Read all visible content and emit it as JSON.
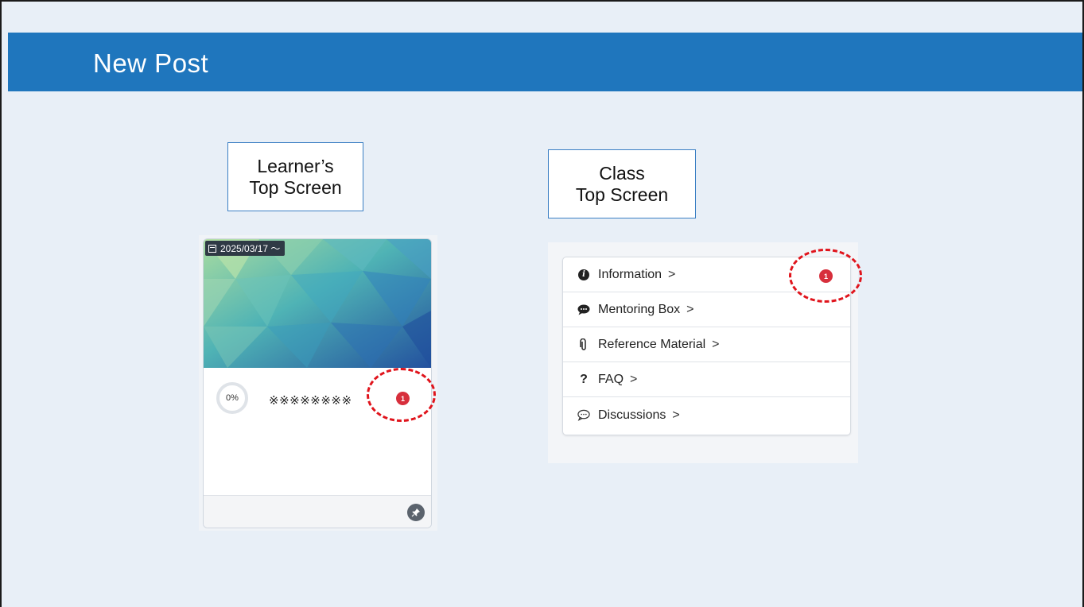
{
  "header": {
    "title": "New Post"
  },
  "labels": {
    "learner_line1": "Learner’s",
    "learner_line2": "Top Screen",
    "class_line1": "Class",
    "class_line2": "Top Screen"
  },
  "learner_card": {
    "date": "2025/03/17 ～",
    "progress": "0%",
    "title": "※※※※※※※※",
    "badge": "1"
  },
  "class_menu": {
    "items": [
      {
        "label": "Information",
        "icon": "info-icon"
      },
      {
        "label": "Mentoring Box",
        "icon": "chat-bubble-icon"
      },
      {
        "label": "Reference Material",
        "icon": "paperclip-icon"
      },
      {
        "label": "FAQ",
        "icon": "question-icon"
      },
      {
        "label": "Discussions",
        "icon": "comment-dots-icon"
      }
    ],
    "chevron": ">",
    "badge": "1"
  },
  "colors": {
    "header": "#1f76bd",
    "background": "#e8eff7",
    "badge": "#d72f3c",
    "highlight": "#e0141c"
  }
}
